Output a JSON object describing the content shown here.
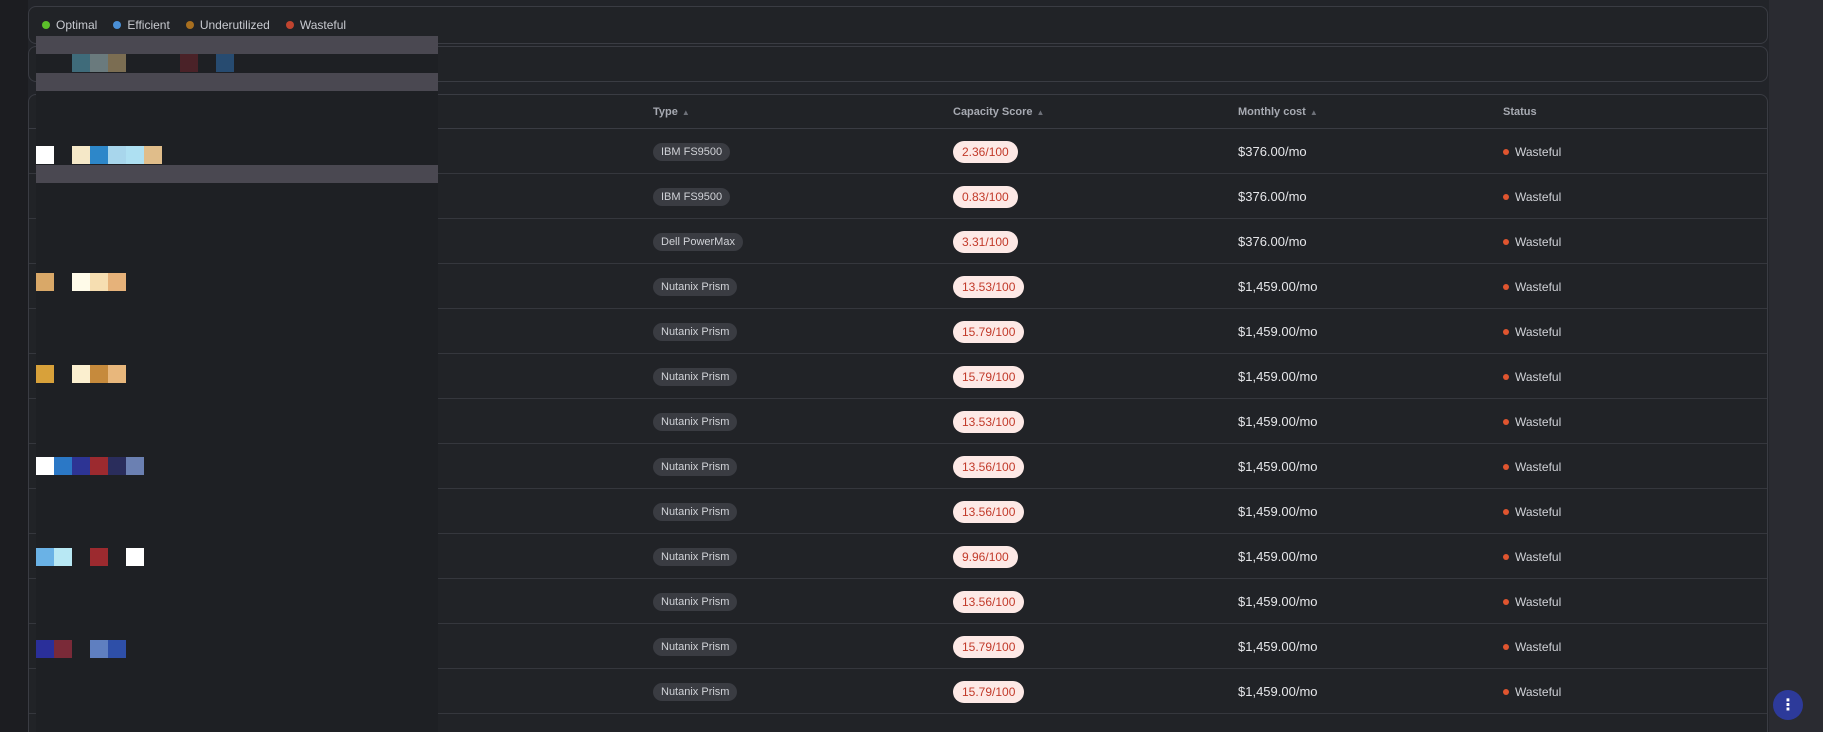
{
  "legend": {
    "items": [
      {
        "label": "Optimal",
        "color": "#5bbf2a"
      },
      {
        "label": "Efficient",
        "color": "#4a8fd6"
      },
      {
        "label": "Underutilized",
        "color": "#a86f1f"
      },
      {
        "label": "Wasteful",
        "color": "#c0442f"
      }
    ]
  },
  "table": {
    "headers": {
      "type": "Type",
      "capacity_score": "Capacity Score",
      "monthly_cost": "Monthly cost",
      "status": "Status"
    },
    "rows": [
      {
        "type": "IBM FS9500",
        "score": "2.36/100",
        "cost": "$376.00/mo",
        "status": "Wasteful"
      },
      {
        "type": "IBM FS9500",
        "score": "0.83/100",
        "cost": "$376.00/mo",
        "status": "Wasteful"
      },
      {
        "type": "Dell PowerMax",
        "score": "3.31/100",
        "cost": "$376.00/mo",
        "status": "Wasteful"
      },
      {
        "type": "Nutanix Prism",
        "score": "13.53/100",
        "cost": "$1,459.00/mo",
        "status": "Wasteful"
      },
      {
        "type": "Nutanix Prism",
        "score": "15.79/100",
        "cost": "$1,459.00/mo",
        "status": "Wasteful"
      },
      {
        "type": "Nutanix Prism",
        "score": "15.79/100",
        "cost": "$1,459.00/mo",
        "status": "Wasteful"
      },
      {
        "type": "Nutanix Prism",
        "score": "13.53/100",
        "cost": "$1,459.00/mo",
        "status": "Wasteful"
      },
      {
        "type": "Nutanix Prism",
        "score": "13.56/100",
        "cost": "$1,459.00/mo",
        "status": "Wasteful"
      },
      {
        "type": "Nutanix Prism",
        "score": "13.56/100",
        "cost": "$1,459.00/mo",
        "status": "Wasteful"
      },
      {
        "type": "Nutanix Prism",
        "score": "9.96/100",
        "cost": "$1,459.00/mo",
        "status": "Wasteful"
      },
      {
        "type": "Nutanix Prism",
        "score": "13.56/100",
        "cost": "$1,459.00/mo",
        "status": "Wasteful"
      },
      {
        "type": "Nutanix Prism",
        "score": "15.79/100",
        "cost": "$1,459.00/mo",
        "status": "Wasteful"
      },
      {
        "type": "Nutanix Prism",
        "score": "15.79/100",
        "cost": "$1,459.00/mo",
        "status": "Wasteful"
      }
    ]
  },
  "fab": {
    "icon": "more-vertical-icon"
  }
}
